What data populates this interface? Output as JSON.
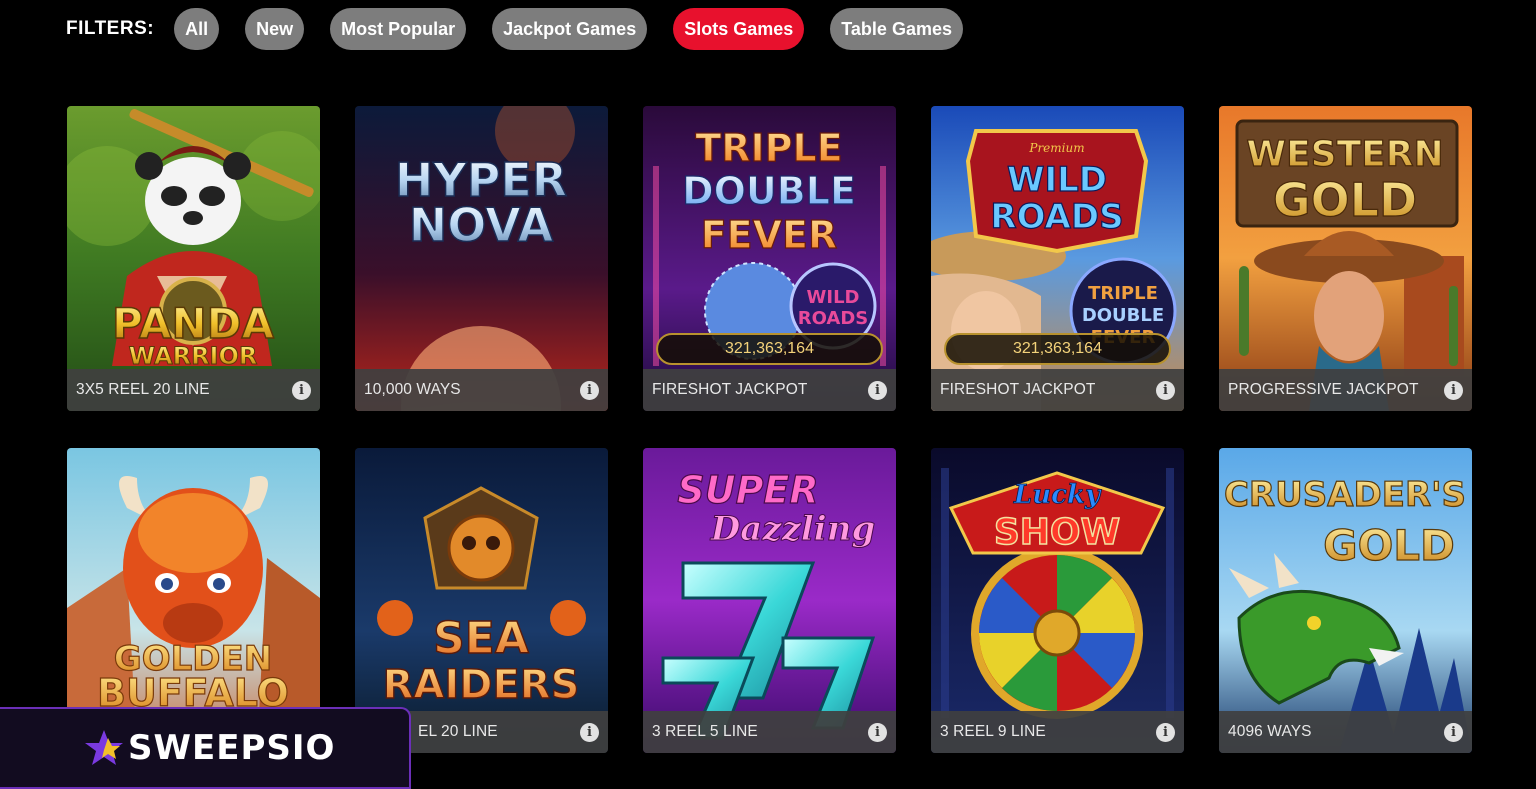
{
  "filters": {
    "label": "FILTERS:",
    "chips": [
      {
        "label": "All",
        "active": false
      },
      {
        "label": "New",
        "active": false
      },
      {
        "label": "Most Popular",
        "active": false
      },
      {
        "label": "Jackpot Games",
        "active": false
      },
      {
        "label": "Slots Games",
        "active": true
      },
      {
        "label": "Table Games",
        "active": false
      }
    ]
  },
  "games": [
    {
      "title_lines": [
        "PANDA",
        "WARRIOR"
      ],
      "caption": "3X5 REEL 20 LINE",
      "jackpot": null
    },
    {
      "title_lines": [
        "HYPER",
        "NOVA"
      ],
      "caption": "10,000 WAYS",
      "jackpot": null
    },
    {
      "title_lines": [
        "TRIPLE",
        "DOUBLE",
        "FEVER"
      ],
      "badge_lines": [
        "WILD",
        "ROADS"
      ],
      "caption": "FIRESHOT JACKPOT",
      "jackpot": "321,363,164"
    },
    {
      "title_top": "Premium",
      "title_lines": [
        "WILD",
        "ROADS"
      ],
      "badge_lines": [
        "TRIPLE",
        "DOUBLE",
        "FEVER"
      ],
      "caption": "FIRESHOT JACKPOT",
      "jackpot": "321,363,164"
    },
    {
      "title_lines": [
        "WESTERN",
        "GOLD"
      ],
      "caption": "PROGRESSIVE JACKPOT",
      "jackpot": null
    },
    {
      "title_lines": [
        "GOLDEN",
        "BUFFALO"
      ],
      "caption": "",
      "jackpot": null
    },
    {
      "title_lines": [
        "SEA",
        "RAIDERS"
      ],
      "caption": "EL 20 LINE",
      "jackpot": null
    },
    {
      "title_lines": [
        "SUPER",
        "Dazzling"
      ],
      "caption": "3 REEL 5 LINE",
      "jackpot": null
    },
    {
      "title_lines": [
        "Lucky",
        "SHOW"
      ],
      "caption": "3 REEL 9 LINE",
      "jackpot": null
    },
    {
      "title_lines": [
        "CRUSADER'S",
        "GOLD"
      ],
      "caption": "4096 WAYS",
      "jackpot": null
    }
  ],
  "info_glyph": "i",
  "brand": {
    "name": "SWEEPSIO",
    "icon": "star-icon",
    "accent": "#6b2fb8"
  },
  "colors": {
    "active_chip": "#e8112d",
    "chip": "#7d7d7d",
    "background": "#000000"
  }
}
